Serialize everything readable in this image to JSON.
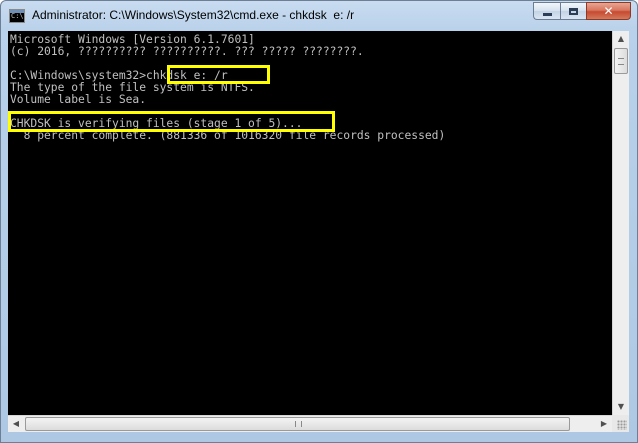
{
  "window": {
    "title": "Administrator: C:\\Windows\\System32\\cmd.exe - chkdsk  e: /r",
    "icon": "cmd-icon",
    "icon_text": "C:\\",
    "buttons": {
      "minimize": "minimize-icon",
      "maximize": "maximize-icon",
      "close_label": "✕"
    }
  },
  "console": {
    "background": "#000000",
    "text_color": "#c0c0c0",
    "highlight_color": "#ffff00",
    "lines": [
      "Microsoft Windows [Version 6.1.7601]",
      "(c) 2016, ?????????? ??????????. ??? ????? ????????.",
      "",
      "C:\\Windows\\system32>chkdsk e: /r",
      "The type of the file system is NTFS.",
      "Volume label is Sea.",
      "",
      "CHKDSK is verifying files (stage 1 of 5)...",
      "  8 percent complete. (881336 of 1016320 file records processed)"
    ]
  },
  "scrollbars": {
    "up_arrow": "▲",
    "down_arrow": "▼",
    "left_arrow": "◀",
    "right_arrow": "▶"
  }
}
